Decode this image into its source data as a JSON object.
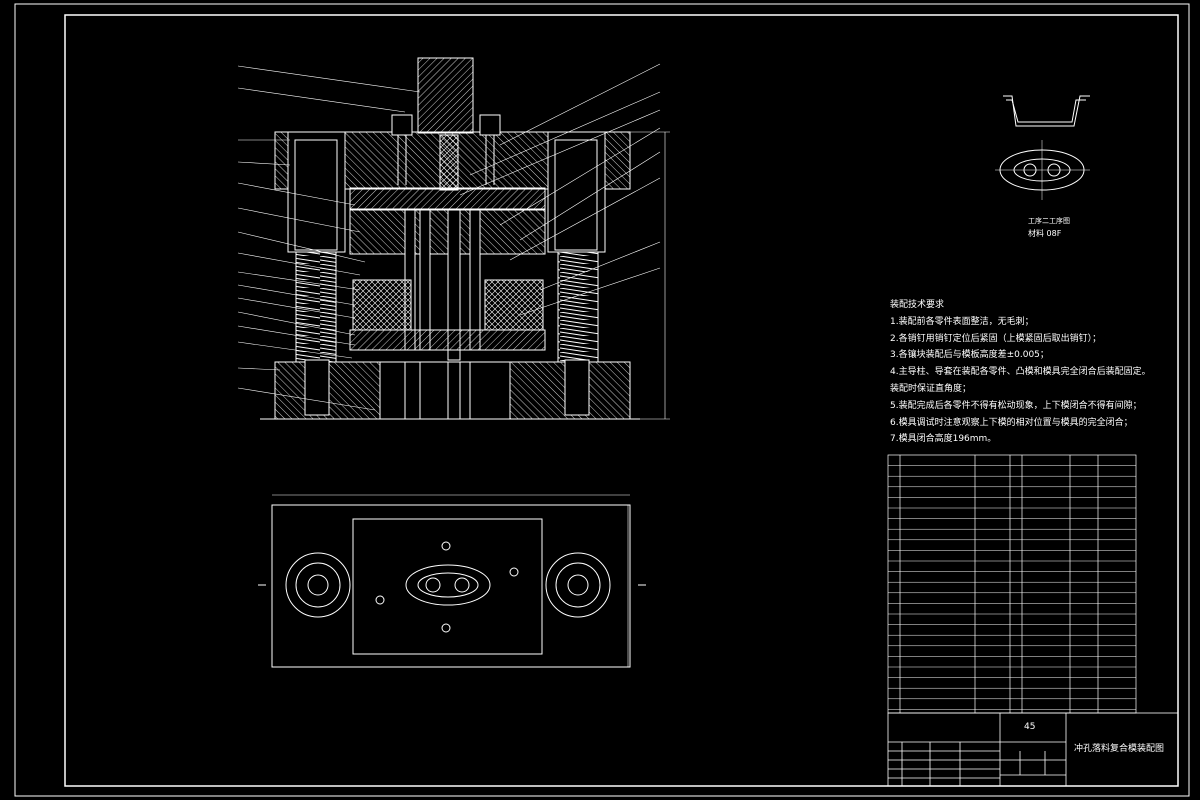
{
  "requirements": {
    "heading": "装配技术要求",
    "items": [
      "1.装配前各零件表面整洁，无毛刺；",
      "2.各销钉用销钉定位后紧固（上模紧固后取出销钉）；",
      "3.各镶块装配后与模板高度差±0.005；",
      "4.主导柱、导套在装配各零件、凸模和模具完全闭合后装配固定。",
      "装配时保证直角度；",
      "5.装配完成后各零件不得有松动现象，上下模闭合不得有间隙；",
      "6.模具调试时注意观察上下模的相对位置与模具的完全闭合；",
      "7.模具闭合高度196mm。"
    ]
  },
  "part_sketch": {
    "caption": "工序二工序图",
    "material": "材料 08F"
  },
  "title_block": {
    "material": "45",
    "drawing_title": "冲孔落料复合模装配图"
  },
  "colors": {
    "background": "#000000",
    "lines": "#ffffff",
    "hatch": "#ffffff"
  }
}
